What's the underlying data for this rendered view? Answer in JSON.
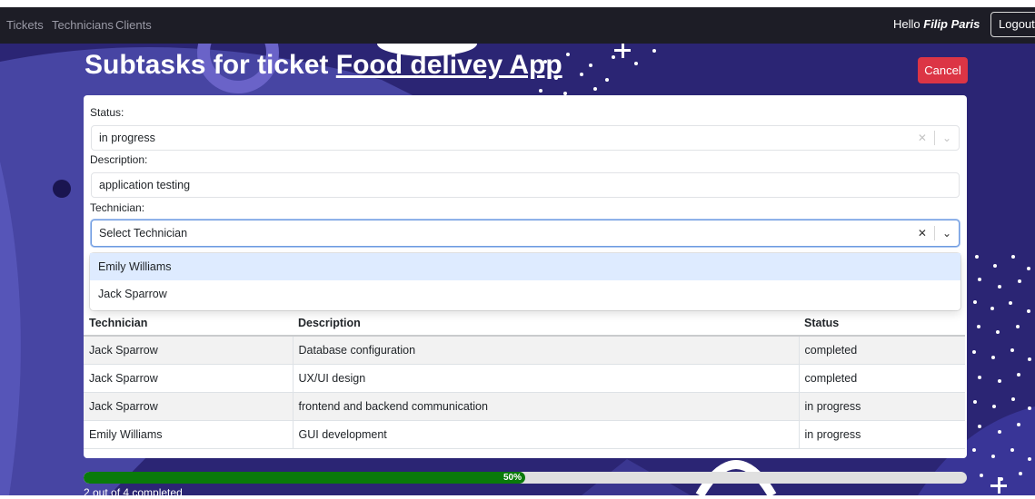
{
  "nav": {
    "links": [
      "Tickets",
      "Technicians",
      "Clients"
    ],
    "greeting": "Hello",
    "user": "Filip Paris",
    "logout": "Logout"
  },
  "page": {
    "title_prefix": "Subtasks for ticket",
    "ticket_name": "Food delivey App",
    "cancel": "Cancel"
  },
  "form": {
    "status_label": "Status:",
    "status_value": "in progress",
    "description_label": "Description:",
    "description_value": "application testing",
    "technician_label": "Technician:",
    "technician_placeholder": "Select Technician",
    "technician_options": [
      "Emily Williams",
      "Jack Sparrow"
    ]
  },
  "table": {
    "headers": [
      "Technician",
      "Description",
      "Status"
    ],
    "rows": [
      [
        "Jack Sparrow",
        "Database configuration",
        "completed"
      ],
      [
        "Jack Sparrow",
        "UX/UI design",
        "completed"
      ],
      [
        "Jack Sparrow",
        "frontend and backend communication",
        "in progress"
      ],
      [
        "Emily Williams",
        "GUI development",
        "in progress"
      ]
    ]
  },
  "progress": {
    "percent": 50,
    "label": "50%",
    "text": "2 out of 4 completed"
  },
  "colors": {
    "background": "#2b2574",
    "topbar": "#1d1d26",
    "cancel": "#dc3545",
    "progress_fill": "#0a7a0a",
    "option_hover": "#deebff"
  },
  "icons": [
    "clear-x-icon",
    "chevron-down-icon"
  ]
}
